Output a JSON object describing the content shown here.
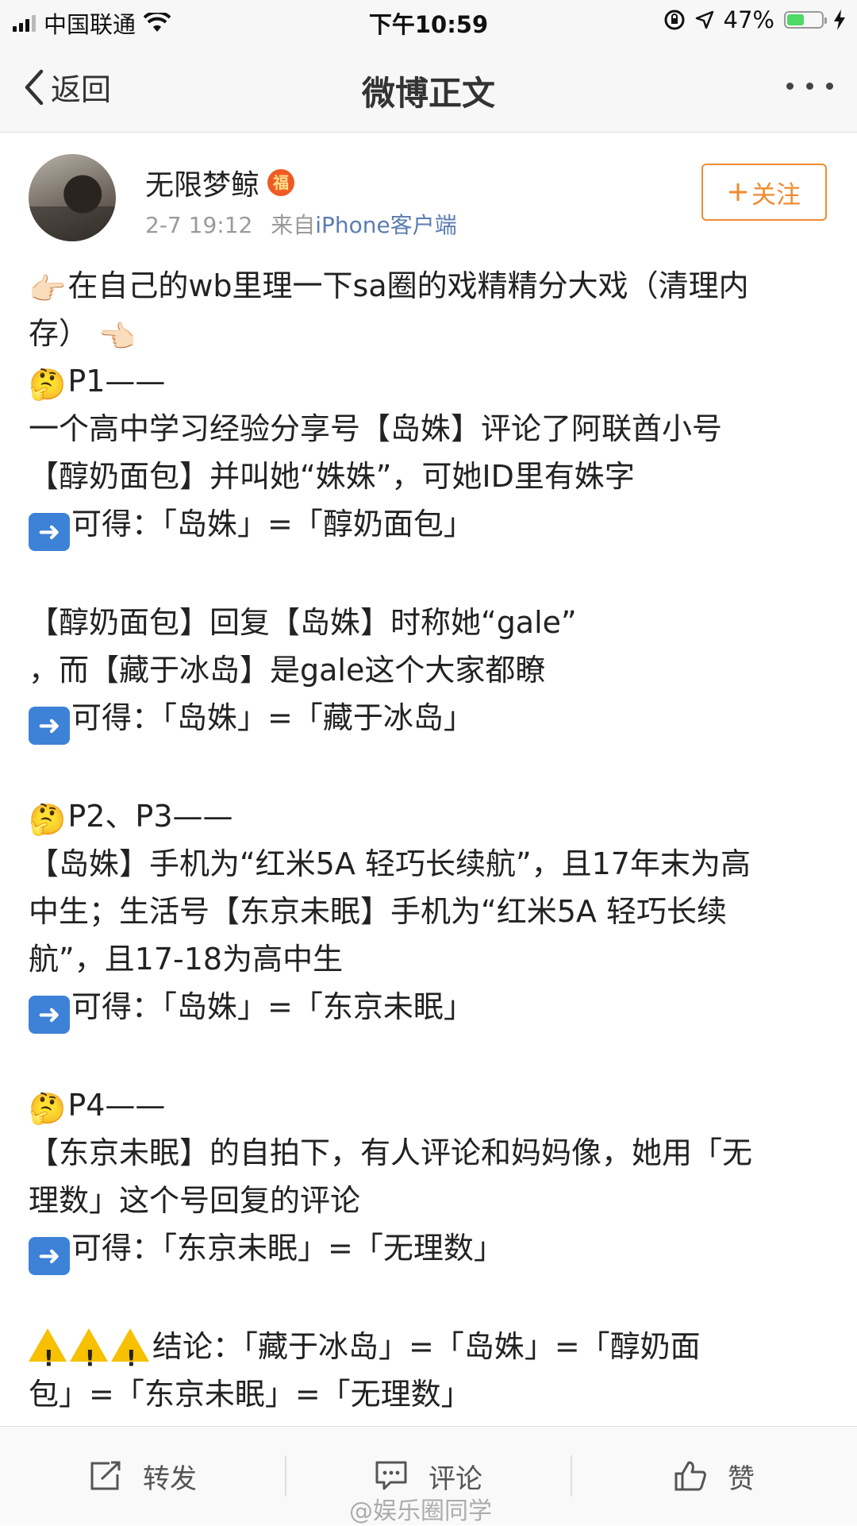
{
  "status_bar": {
    "carrier": "中国联通",
    "time": "下午10:59",
    "battery": "47%"
  },
  "nav": {
    "back_label": "返回",
    "title": "微博正文"
  },
  "author": {
    "name": "无限梦鲸",
    "badge_text": "福",
    "date": "2-7 19:12",
    "source_prefix": "来自",
    "source": "iPhone客户端",
    "follow_label": "关注"
  },
  "post": {
    "l1": "在自己的wb里理一下sa圈的戏精精分大戏（清理内",
    "l2": "存）",
    "p1_head": "P1——",
    "p1_a": "一个高中学习经验分享号【岛姝】评论了阿联酋小号",
    "p1_b": "【醇奶面包】并叫她“姝姝”，可她ID里有姝字",
    "p1_c": "可得：「岛姝」=「醇奶面包」",
    "p1_d": "【醇奶面包】回复【岛姝】时称她“gale”",
    "p1_e": "，而【藏于冰岛】是gale这个大家都瞭",
    "p1_f": "可得：「岛姝」=「藏于冰岛」",
    "p23_head": "P2、P3——",
    "p23_a": "【岛姝】手机为“红米5A 轻巧长续航”，且17年末为高",
    "p23_b": "中生；生活号【东京未眠】手机为“红米5A 轻巧长续",
    "p23_c": "航”，且17-18为高中生",
    "p23_d": "可得：「岛姝」=「东京未眠」",
    "p4_head": "P4——",
    "p4_a": "【东京未眠】的自拍下，有人评论和妈妈像，她用「无",
    "p4_b": "理数」这个号回复的评论",
    "p4_c": "可得：「东京未眠」=「无理数」",
    "concl_a": "结论：「藏于冰岛」=「岛姝」=「醇奶面",
    "concl_b": "包」=「东京未眠」=「无理数」"
  },
  "toolbar": {
    "repost": "转发",
    "comment": "评论",
    "like": "赞"
  },
  "watermark": "@娱乐圈同学",
  "colors": {
    "accent_orange": "#f08b2f",
    "link_blue": "#5b7db1",
    "arrow_blue": "#3d82d6",
    "warn_yellow": "#f7c000"
  },
  "icons": [
    "signal-icon",
    "wifi-icon",
    "lock-rotation-icon",
    "location-arrow-icon",
    "battery-icon",
    "charging-icon",
    "back-chevron-icon",
    "more-dots-icon",
    "pointing-right-emoji",
    "pointing-left-emoji",
    "thinking-emoji",
    "arrow-right-emoji",
    "warning-emoji",
    "repost-icon",
    "comment-icon",
    "like-icon"
  ]
}
